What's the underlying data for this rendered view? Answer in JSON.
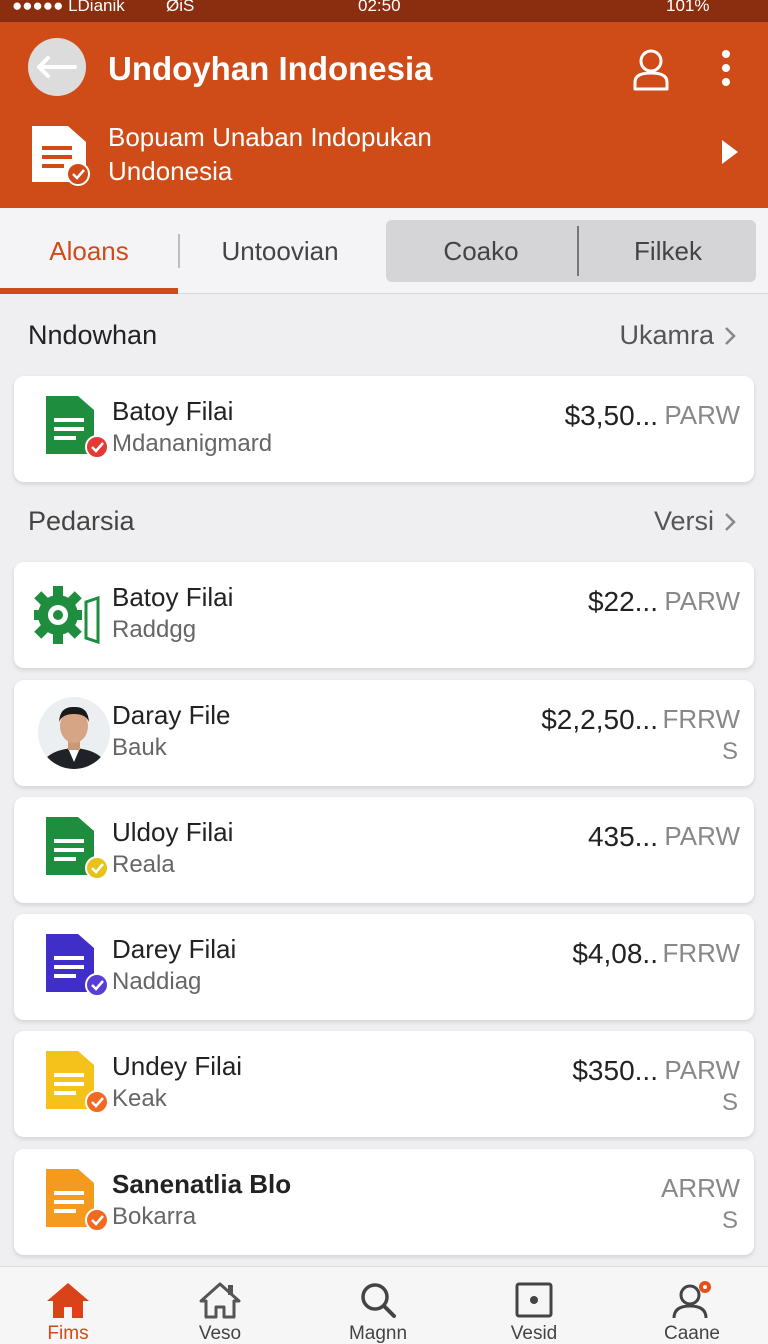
{
  "status_bar": {
    "carrier": "●●●●● LDianik",
    "network": "ØiS",
    "time": "02:50",
    "battery": "101%"
  },
  "header": {
    "title": "Undoyhan Indonesia",
    "subtitle_line1": "Bopuam Unaban Indopukan",
    "subtitle_line2": "Undonesia"
  },
  "tabs": [
    "Aloans",
    "Untoovian",
    "Coako",
    "Filkek"
  ],
  "sections": [
    {
      "title": "Nndowhan",
      "link": "Ukamra"
    },
    {
      "title": "Pedarsia",
      "link": "Versi"
    }
  ],
  "cards": [
    {
      "name": "Batoy Filai",
      "sub": "Mdananigmard",
      "amount": "$3,50...",
      "code": "PARW",
      "code2": "",
      "icon": "green-document-icon",
      "badge": "red-check-badge"
    },
    {
      "name": "Batoy Filai",
      "sub": "Raddgg",
      "amount": "$22...",
      "code": "PARW",
      "code2": "",
      "icon": "green-gear-icon",
      "badge": ""
    },
    {
      "name": "Daray File",
      "sub": "Bauk",
      "amount": "$2,2,50...",
      "code": "FRRW",
      "code2": "S",
      "icon": "person-avatar",
      "badge": ""
    },
    {
      "name": "Uldoy Filai",
      "sub": "Reala",
      "amount": "435...",
      "code": "PARW",
      "code2": "",
      "icon": "green-document-icon",
      "badge": "yellow-check-badge"
    },
    {
      "name": "Darey Filai",
      "sub": "Naddiag",
      "amount": "$4,08..",
      "code": "FRRW",
      "code2": "",
      "icon": "purple-document-icon",
      "badge": "purple-check-badge"
    },
    {
      "name": "Undey Filai",
      "sub": "Keak",
      "amount": "$350...",
      "code": "PARW",
      "code2": "S",
      "icon": "yellow-document-icon",
      "badge": "orange-check-badge"
    },
    {
      "name": "Sanenatlia Blo",
      "sub": "Bokarra",
      "amount": "",
      "code": "ARRW",
      "code2": "S",
      "icon": "orange-document-icon",
      "badge": "orange-check-badge"
    }
  ],
  "bottom_nav": [
    "Fims",
    "Veso",
    "Magnn",
    "Vesid",
    "Caane"
  ],
  "colors": {
    "accent": "#cf4b18",
    "green": "#1e8e3e",
    "purple": "#3f2fc8",
    "yellow": "#f5c21b",
    "orange": "#f39a1f"
  }
}
